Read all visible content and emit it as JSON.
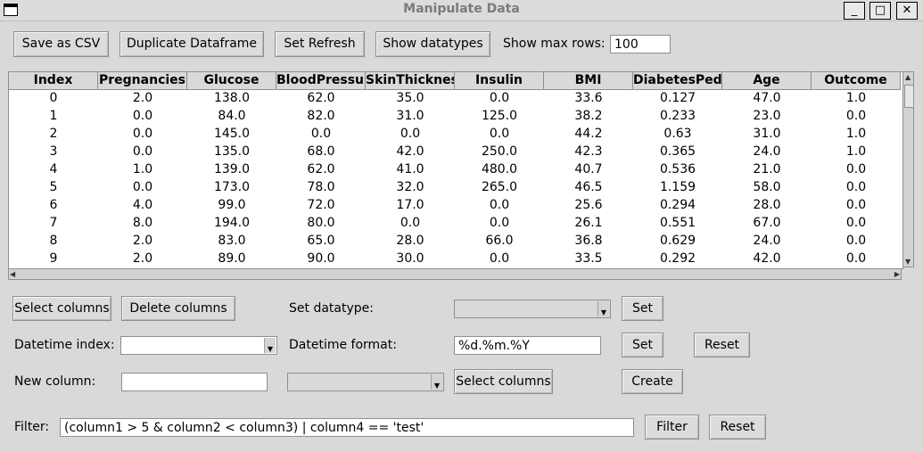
{
  "window": {
    "title": "Manipulate Data",
    "minimize": "_",
    "maximize": "□",
    "close": "✕"
  },
  "toolbar": {
    "save_csv": "Save as CSV",
    "duplicate": "Duplicate Dataframe",
    "set_refresh": "Set Refresh",
    "show_datatypes": "Show datatypes",
    "max_rows_label": "Show max rows:",
    "max_rows_value": "100"
  },
  "table": {
    "columns": [
      "Index",
      "Pregnancies",
      "Glucose",
      "BloodPressure",
      "SkinThickness",
      "Insulin",
      "BMI",
      "DiabetesPedigreeFunction",
      "Age",
      "Outcome"
    ],
    "rows": [
      [
        "0",
        "2.0",
        "138.0",
        "62.0",
        "35.0",
        "0.0",
        "33.6",
        "0.127",
        "47.0",
        "1.0"
      ],
      [
        "1",
        "0.0",
        "84.0",
        "82.0",
        "31.0",
        "125.0",
        "38.2",
        "0.233",
        "23.0",
        "0.0"
      ],
      [
        "2",
        "0.0",
        "145.0",
        "0.0",
        "0.0",
        "0.0",
        "44.2",
        "0.63",
        "31.0",
        "1.0"
      ],
      [
        "3",
        "0.0",
        "135.0",
        "68.0",
        "42.0",
        "250.0",
        "42.3",
        "0.365",
        "24.0",
        "1.0"
      ],
      [
        "4",
        "1.0",
        "139.0",
        "62.0",
        "41.0",
        "480.0",
        "40.7",
        "0.536",
        "21.0",
        "0.0"
      ],
      [
        "5",
        "0.0",
        "173.0",
        "78.0",
        "32.0",
        "265.0",
        "46.5",
        "1.159",
        "58.0",
        "0.0"
      ],
      [
        "6",
        "4.0",
        "99.0",
        "72.0",
        "17.0",
        "0.0",
        "25.6",
        "0.294",
        "28.0",
        "0.0"
      ],
      [
        "7",
        "8.0",
        "194.0",
        "80.0",
        "0.0",
        "0.0",
        "26.1",
        "0.551",
        "67.0",
        "0.0"
      ],
      [
        "8",
        "2.0",
        "83.0",
        "65.0",
        "28.0",
        "66.0",
        "36.8",
        "0.629",
        "24.0",
        "0.0"
      ],
      [
        "9",
        "2.0",
        "89.0",
        "90.0",
        "30.0",
        "0.0",
        "33.5",
        "0.292",
        "42.0",
        "0.0"
      ]
    ]
  },
  "controls": {
    "select_columns": "Select columns",
    "delete_columns": "Delete columns",
    "set_datatype_label": "Set datatype:",
    "set_datatype_value": "",
    "set": "Set",
    "datetime_index_label": "Datetime index:",
    "datetime_index_value": "",
    "datetime_format_label": "Datetime format:",
    "datetime_format_value": "%d.%m.%Y",
    "set2": "Set",
    "reset": "Reset",
    "new_column_label": "New column:",
    "new_column_value": "",
    "new_column_type": "",
    "select_columns2": "Select columns",
    "create": "Create",
    "filter_label": "Filter:",
    "filter_value": "(column1 > 5 & column2 < column3) | column4 == 'test'",
    "filter_button": "Filter",
    "filter_reset": "Reset"
  }
}
